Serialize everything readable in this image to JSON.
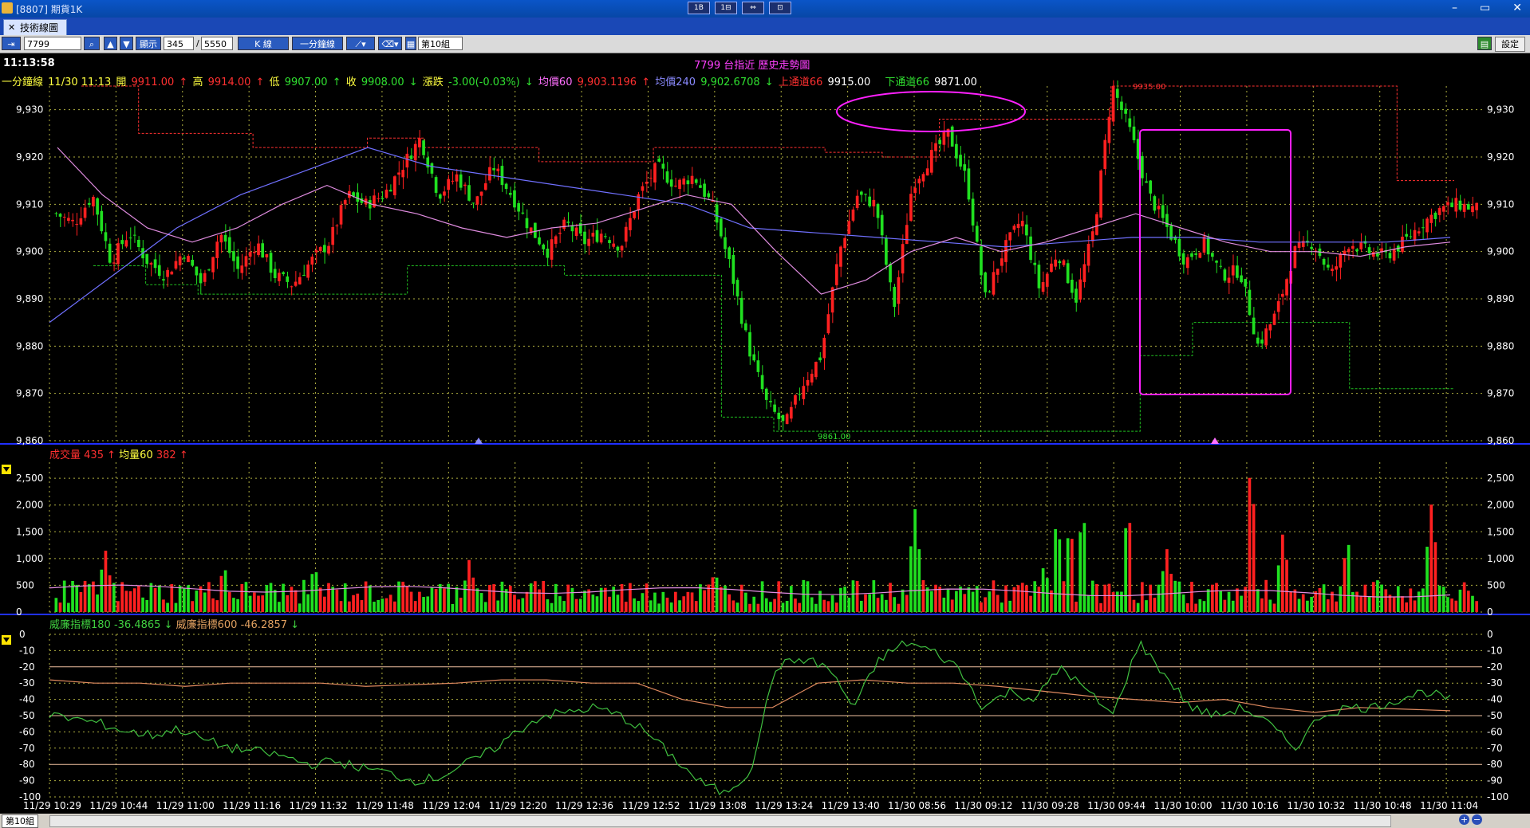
{
  "window": {
    "title": "[8807] 期貨1K",
    "ctrl_min": "–",
    "ctrl_max": "▭",
    "ctrl_close": "✕",
    "center_buttons": [
      "1B",
      "1⊟",
      "⇔",
      "⊡"
    ]
  },
  "tab": {
    "label": "技術線圖"
  },
  "toolbar": {
    "symbol": "7799",
    "display_label": "顯示",
    "display_count": "345",
    "separator": "/",
    "total_count": "5550",
    "kline_label": "K 線",
    "period_label": "一分鐘線",
    "group_label": "第10組",
    "setting_label": "設定"
  },
  "clock": "11:13:58",
  "chart_title": "7799 台指近  歷史走勢圖",
  "info": {
    "period": "一分鐘線",
    "datetime": "11/30 11:13",
    "open_label": "開",
    "open": "9911.00",
    "high_label": "高",
    "high": "9914.00",
    "low_label": "低",
    "low": "9907.00",
    "close_label": "收",
    "close": "9908.00",
    "change_label": "漲跌",
    "change": "-3.00(-0.03%)",
    "ma60_label": "均價60",
    "ma60": "9,903.1196",
    "ma240_label": "均價240",
    "ma240": "9,902.6708",
    "upper_label": "上通道66",
    "upper": "9915.00",
    "lower_label": "下通道66",
    "lower": "9871.00"
  },
  "volume_legend": {
    "label": "成交量",
    "value": "435",
    "ma_label": "均量60",
    "ma_value": "382"
  },
  "williams_legend": {
    "label1": "威廉指標180",
    "value1": "-36.4865",
    "label2": "威廉指標600",
    "value2": "-46.2857"
  },
  "statusbar": {
    "group": "第10組"
  },
  "colors": {
    "up": "#ff2020",
    "down": "#20e020",
    "ma60": "#e08ce0",
    "ma240": "#7070ff",
    "upper_channel": "#ff3030",
    "lower_channel": "#20c020",
    "annotation": "#ff20ff",
    "williams180": "#40c040",
    "williams600": "#e08a60",
    "grid": "#b0b040"
  },
  "chart_data": {
    "type": "candlestick",
    "price_axis": {
      "ticks": [
        "9,930",
        "9,920",
        "9,910",
        "9,900",
        "9,890",
        "9,880",
        "9,870",
        "9,860"
      ],
      "range": [
        9860,
        9935
      ]
    },
    "price_annotations": [
      {
        "label": "9935.00"
      },
      {
        "label": "9861.00"
      }
    ],
    "time_labels": [
      "11/29 10:29",
      "11/29 10:44",
      "11/29 11:00",
      "11/29 11:16",
      "11/29 11:32",
      "11/29 11:48",
      "11/29 12:04",
      "11/29 12:20",
      "11/29 12:36",
      "11/29 12:52",
      "11/29 13:08",
      "11/29 13:24",
      "11/29 13:40",
      "11/30 08:56",
      "11/30 09:12",
      "11/30 09:28",
      "11/30 09:44",
      "11/30 10:00",
      "11/30 10:16",
      "11/30 10:32",
      "11/30 10:48",
      "11/30 11:04"
    ],
    "close_path": [
      9908,
      9906,
      9912,
      9898,
      9904,
      9898,
      9895,
      9900,
      9893,
      9904,
      9896,
      9902,
      9895,
      9893,
      9898,
      9902,
      9912,
      9910,
      9912,
      9918,
      9924,
      9912,
      9916,
      9910,
      9918,
      9912,
      9905,
      9900,
      9906,
      9902,
      9904,
      9901,
      9912,
      9918,
      9914,
      9916,
      9910,
      9897,
      9880,
      9868,
      9863,
      9872,
      9878,
      9900,
      9912,
      9910,
      9888,
      9914,
      9920,
      9925,
      9915,
      9890,
      9900,
      9907,
      9892,
      9900,
      9890,
      9905,
      9935,
      9925,
      9912,
      9905,
      9898,
      9902,
      9895,
      9896,
      9880,
      9887,
      9900,
      9902,
      9895,
      9902,
      9900,
      9899,
      9902,
      9906,
      9909,
      9910,
      9909
    ],
    "ma60_path": [
      9922,
      9912,
      9905,
      9902,
      9905,
      9910,
      9914,
      9910,
      9908,
      9905,
      9903,
      9905,
      9906,
      9909,
      9912,
      9910,
      9900,
      9891,
      9894,
      9900,
      9903,
      9900,
      9902,
      9905,
      9908,
      9905,
      9902,
      9900,
      9900,
      9899,
      9901,
      9902
    ],
    "ma240_path": [
      9885,
      9895,
      9905,
      9912,
      9917,
      9922,
      9918,
      9916,
      9914,
      9912,
      9910,
      9905,
      9904,
      9903,
      9902,
      9901,
      9902,
      9903,
      9903,
      9902,
      9902,
      9902,
      9903
    ],
    "upper_channel_path": [
      9935,
      9925,
      9925,
      9922,
      9922,
      9924,
      9922,
      9922,
      9919,
      9919,
      9922,
      9922,
      9922,
      9921,
      9920,
      9928,
      9928,
      9928,
      9935,
      9935,
      9935,
      9935,
      9935,
      9915
    ],
    "lower_channel_path": [
      9897,
      9893,
      9891,
      9891,
      9891,
      9891,
      9897,
      9897,
      9897,
      9895,
      9895,
      9895,
      9865,
      9862,
      9862,
      9862,
      9862,
      9862,
      9862,
      9862,
      9878,
      9885,
      9885,
      9885,
      9871,
      9871
    ],
    "volume_axis": {
      "ticks": [
        "2,500",
        "2,000",
        "1,500",
        "1,000",
        "500",
        "0"
      ],
      "max": 2800
    },
    "volume_spikes": [
      {
        "at": 0.038,
        "value": 1200
      },
      {
        "at": 0.13,
        "value": 900
      },
      {
        "at": 0.2,
        "value": 900
      },
      {
        "at": 0.32,
        "value": 1000
      },
      {
        "at": 0.51,
        "value": 800
      },
      {
        "at": 0.665,
        "value": 1950
      },
      {
        "at": 0.765,
        "value": 900
      },
      {
        "at": 0.775,
        "value": 1800
      },
      {
        "at": 0.785,
        "value": 1700
      },
      {
        "at": 0.795,
        "value": 1950
      },
      {
        "at": 0.83,
        "value": 2000
      },
      {
        "at": 0.86,
        "value": 1200
      },
      {
        "at": 0.925,
        "value": 2800
      },
      {
        "at": 0.95,
        "value": 1500
      },
      {
        "at": 1.0,
        "value": 1400
      },
      {
        "at": 1.065,
        "value": 2050
      }
    ],
    "williams_axis": {
      "ticks": [
        "0",
        "-10",
        "-20",
        "-30",
        "-40",
        "-50",
        "-60",
        "-70",
        "-80",
        "-90",
        "-100"
      ],
      "range": [
        -100,
        0
      ]
    },
    "williams180_path": [
      -50,
      -52,
      -55,
      -60,
      -62,
      -58,
      -65,
      -70,
      -72,
      -75,
      -80,
      -78,
      -82,
      -85,
      -90,
      -88,
      -80,
      -72,
      -60,
      -50,
      -48,
      -45,
      -50,
      -60,
      -75,
      -90,
      -98,
      -85,
      -20,
      -15,
      -20,
      -45,
      -15,
      -5,
      -10,
      -20,
      -45,
      -35,
      -40,
      -20,
      -35,
      -50,
      -5,
      -25,
      -45,
      -50,
      -45,
      -55,
      -70,
      -50,
      -45,
      -45,
      -40,
      -35,
      -40
    ],
    "williams600_path": [
      -28,
      -30,
      -30,
      -32,
      -30,
      -30,
      -30,
      -32,
      -31,
      -30,
      -28,
      -28,
      -30,
      -30,
      -40,
      -45,
      -45,
      -30,
      -28,
      -30,
      -30,
      -32,
      -35,
      -38,
      -40,
      -42,
      -40,
      -45,
      -48,
      -45,
      -46,
      -47
    ],
    "annotation_overlays": [
      {
        "type": "ellipse"
      },
      {
        "type": "rectangle"
      }
    ]
  }
}
